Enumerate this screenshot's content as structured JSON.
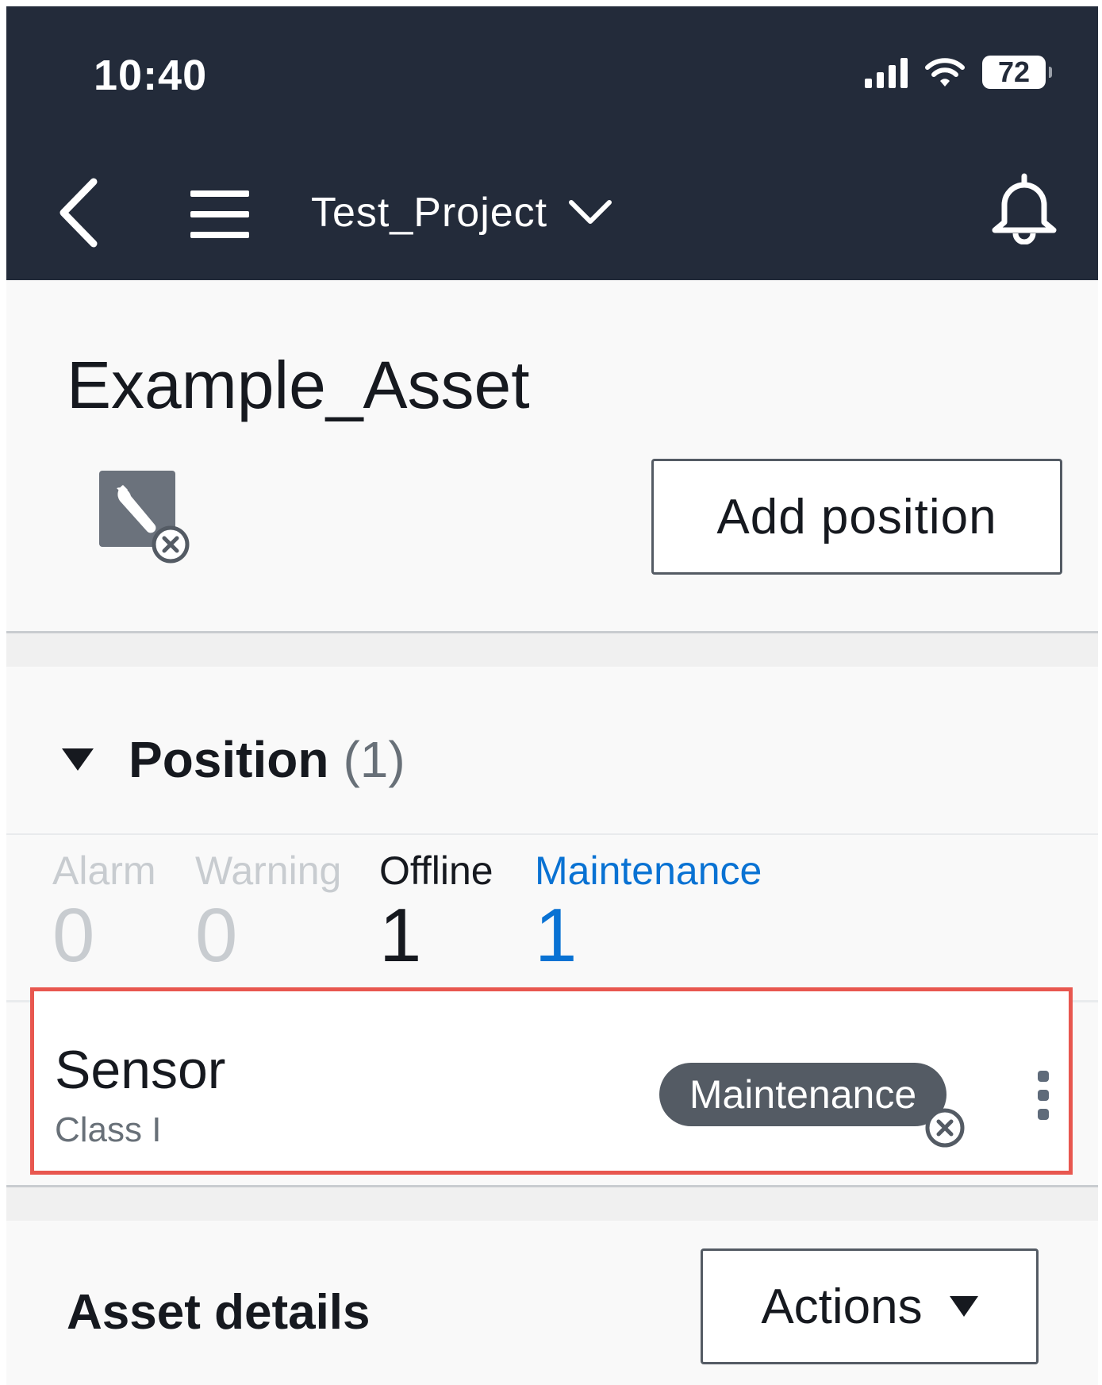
{
  "status_bar": {
    "time": "10:40",
    "battery": "72"
  },
  "header": {
    "project": "Test_Project"
  },
  "asset": {
    "title": "Example_Asset",
    "add_position_label": "Add position"
  },
  "position": {
    "title": "Position",
    "count": "(1)",
    "stats": [
      {
        "label": "Alarm",
        "value": "0"
      },
      {
        "label": "Warning",
        "value": "0"
      },
      {
        "label": "Offline",
        "value": "1"
      },
      {
        "label": "Maintenance",
        "value": "1"
      }
    ],
    "items": [
      {
        "name": "Sensor",
        "class": "Class I",
        "status": "Maintenance"
      }
    ]
  },
  "details": {
    "title": "Asset details",
    "actions_label": "Actions"
  },
  "colors": {
    "header_bg": "#232b3a",
    "accent": "#0972d3",
    "highlight": "#e8574f",
    "badge_bg": "#545b64"
  }
}
